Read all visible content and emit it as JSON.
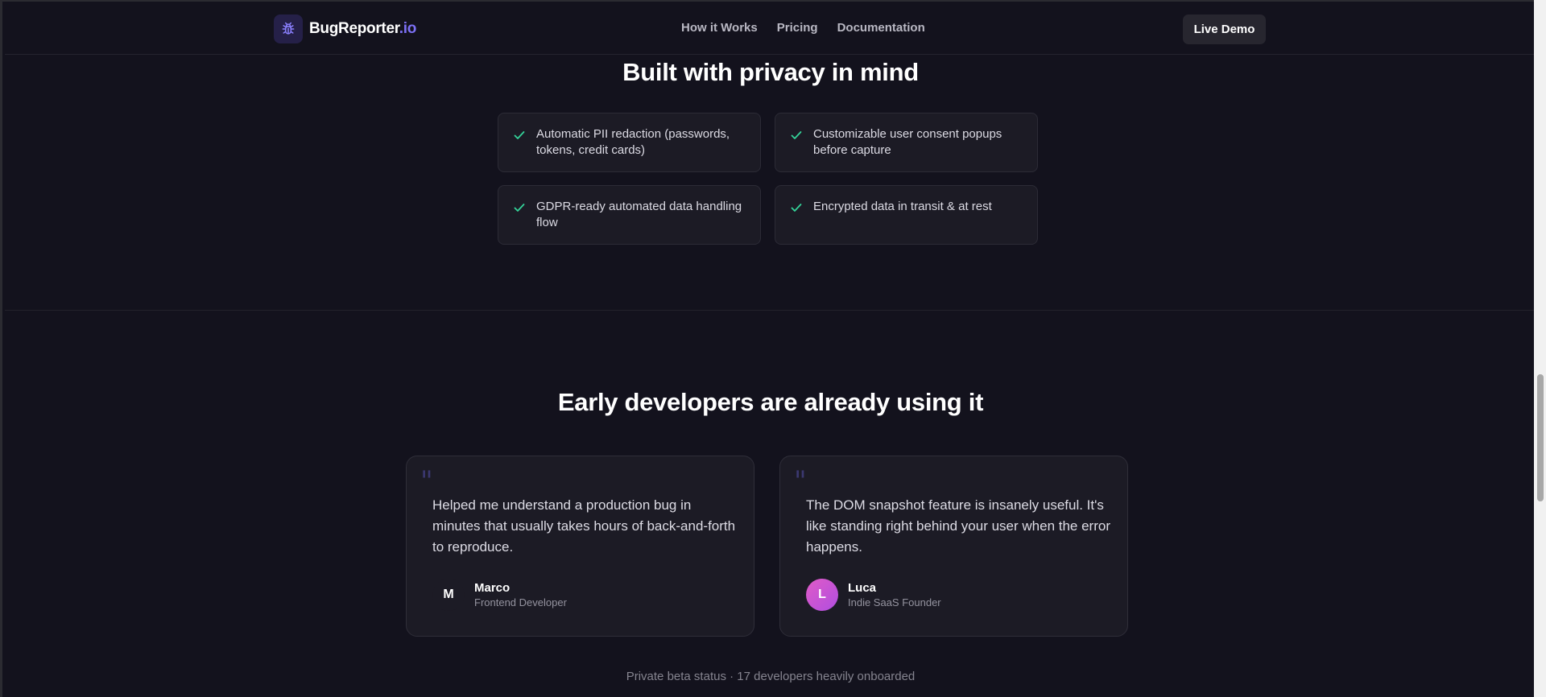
{
  "nav": {
    "logo_name": "BugReporter",
    "logo_tld": ".io",
    "logo_icon": "bug-icon",
    "links": [
      "How it Works",
      "Pricing",
      "Documentation"
    ],
    "cta": "Live Demo"
  },
  "privacy": {
    "title": "Built with privacy in mind",
    "features": [
      "Automatic PII redaction (passwords, tokens, credit cards)",
      "Customizable user consent popups before capture",
      "GDPR-ready automated data handling flow",
      "Encrypted data in transit & at rest"
    ],
    "check_icon": "check-icon",
    "check_color": "#34d399"
  },
  "testimonials": {
    "title": "Early developers are already using it",
    "items": [
      {
        "quote": "Helped me understand a production bug in minutes that usually takes hours of back-and-forth to reproduce.",
        "initial": "M",
        "name": "Marco",
        "role": "Frontend Developer"
      },
      {
        "quote": "The DOM snapshot feature is insanely useful. It's like standing right behind your user when the error happens.",
        "initial": "L",
        "name": "Luca",
        "role": "Indie SaaS Founder"
      }
    ],
    "footer": "Private beta status · 17 developers heavily onboarded"
  },
  "colors": {
    "background": "#13121d",
    "accent": "#7c70f5"
  }
}
